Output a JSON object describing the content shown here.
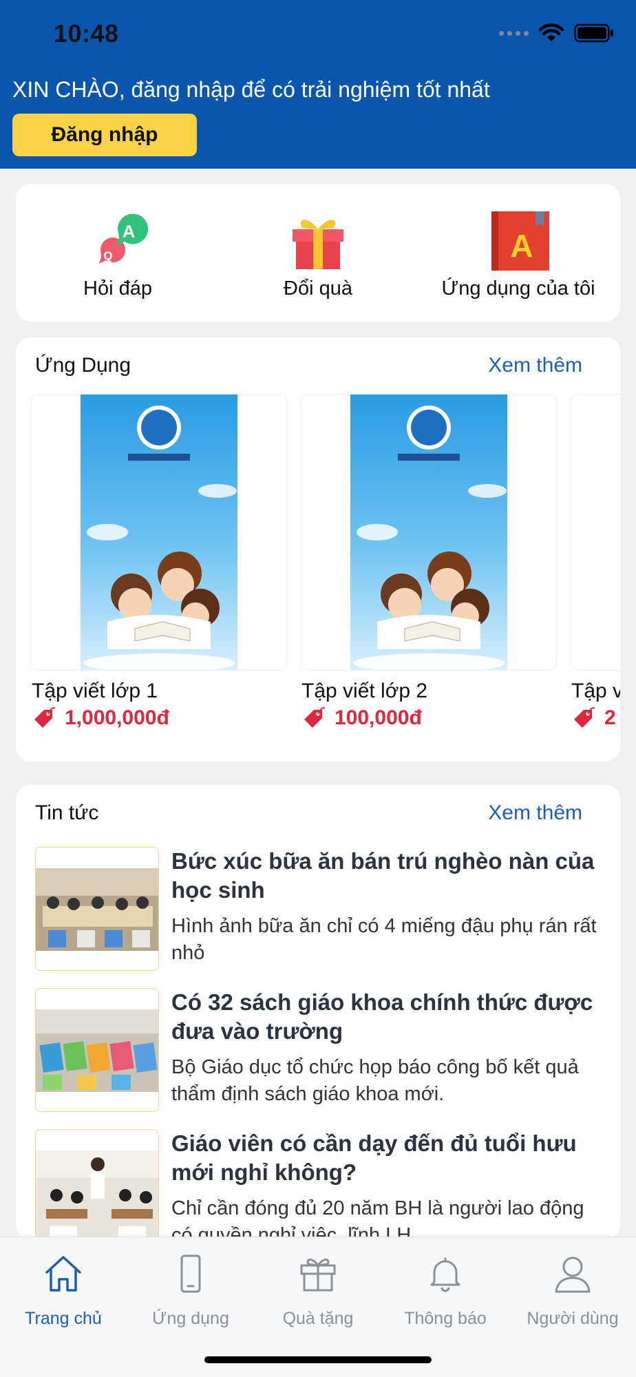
{
  "status_bar": {
    "time": "10:48"
  },
  "header": {
    "greeting": "XIN CHÀO, đăng nhập để có trải nghiệm tốt nhất",
    "login_label": "Đăng nhập"
  },
  "quick_actions": [
    {
      "label": "Hỏi đáp",
      "icon": "qa-bubbles-icon"
    },
    {
      "label": "Đổi quà",
      "icon": "gift-icon"
    },
    {
      "label": "Ứng dụng của tôi",
      "icon": "book-a-icon"
    }
  ],
  "apps": {
    "title": "Ứng Dụng",
    "see_more": "Xem thêm",
    "items": [
      {
        "name": "Tập viết lớp 1",
        "price": "1,000,000đ"
      },
      {
        "name": "Tập viết lớp 2",
        "price": "100,000đ"
      },
      {
        "name": "Tập v",
        "price": "2"
      }
    ]
  },
  "news": {
    "title": "Tin tức",
    "see_more": "Xem thêm",
    "items": [
      {
        "title": "Bức xúc bữa ăn bán trú nghèo nàn của học sinh",
        "desc": "Hình ảnh bữa ăn chỉ có 4 miếng đậu phụ rán rất nhỏ"
      },
      {
        "title": "Có 32 sách giáo khoa chính thức được đưa vào trường",
        "desc": "Bộ Giáo dục tổ chức họp báo công bố kết quả thẩm định sách giáo khoa mới."
      },
      {
        "title": "Giáo viên có cần dạy đến đủ tuổi hưu mới nghỉ không?",
        "desc": "Chỉ cần đóng đủ 20 năm BH là người lao động có quyền nghỉ việc, lĩnh LH"
      }
    ]
  },
  "tabs": [
    {
      "label": "Trang chủ",
      "icon": "home-icon",
      "active": true
    },
    {
      "label": "Ứng dụng",
      "icon": "phone-icon"
    },
    {
      "label": "Quà tặng",
      "icon": "gift-outline-icon"
    },
    {
      "label": "Thông báo",
      "icon": "bell-icon"
    },
    {
      "label": "Người dùng",
      "icon": "user-icon"
    }
  ],
  "colors": {
    "header_bg": "#0b56ad",
    "login_bg": "#fbd347",
    "accent": "#1f5fae",
    "price": "#e0273d"
  }
}
